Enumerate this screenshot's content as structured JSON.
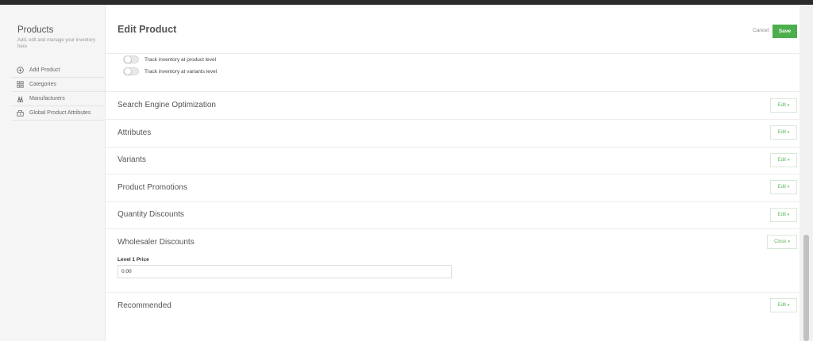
{
  "sidebar": {
    "title": "Products",
    "description": "Add, edit and manage your inventory here",
    "items": [
      {
        "label": "Add Product",
        "icon": "plus-circle-icon"
      },
      {
        "label": "Categories",
        "icon": "grid-icon"
      },
      {
        "label": "Manufacturers",
        "icon": "factory-icon"
      },
      {
        "label": "Global Product Attributes",
        "icon": "attributes-icon"
      }
    ]
  },
  "header": {
    "title": "Edit Product",
    "cancel_label": "Cancel",
    "save_label": "Save"
  },
  "inventory": {
    "track_product_label": "Track inventory at product level",
    "track_variants_label": "Track inventory at variants level"
  },
  "sections": [
    {
      "title": "Search Engine Optimization",
      "action": "Edit"
    },
    {
      "title": "Attributes",
      "action": "Edit"
    },
    {
      "title": "Variants",
      "action": "Edit"
    },
    {
      "title": "Product Promotions",
      "action": "Edit"
    },
    {
      "title": "Quantity Discounts",
      "action": "Edit"
    },
    {
      "title": "Wholesaler Discounts",
      "action": "Close"
    },
    {
      "title": "Recommended",
      "action": "Edit"
    }
  ],
  "wholesaler": {
    "level1_label": "Level 1 Price",
    "level1_value": "0.00"
  },
  "colors": {
    "accent": "#4cae4c",
    "sidebar_bg": "#f5f5f5",
    "topbar": "#2b2b2b"
  }
}
